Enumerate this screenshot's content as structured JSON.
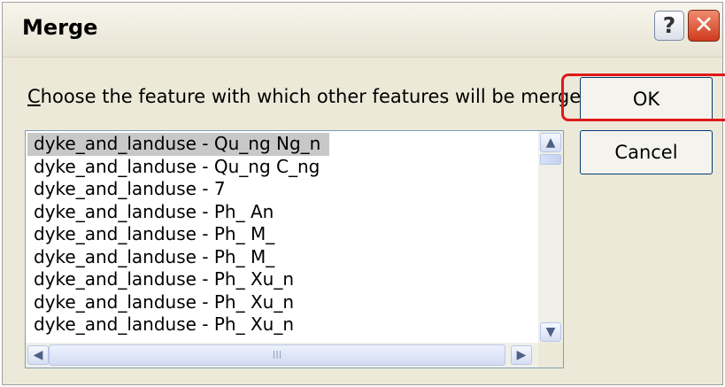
{
  "window": {
    "title": "Merge",
    "help_glyph": "?",
    "close_glyph": "✕"
  },
  "prompt": {
    "accel": "C",
    "rest": "hoose the feature with which other features will be merged:"
  },
  "buttons": {
    "ok_label": "OK",
    "cancel_label": "Cancel"
  },
  "list": {
    "selected_index": 0,
    "items": [
      "dyke_and_landuse - Qu_ng Ng_n",
      "dyke_and_landuse - Qu_ng C_ng",
      "dyke_and_landuse - 7",
      "dyke_and_landuse - Ph_ An",
      "dyke_and_landuse - Ph_ M_",
      "dyke_and_landuse - Ph_ M_",
      "dyke_and_landuse - Ph_ Xu_n",
      "dyke_and_landuse - Ph_ Xu_n",
      "dyke_and_landuse - Ph_ Xu_n"
    ]
  },
  "scroll": {
    "up_glyph": "▲",
    "down_glyph": "▼",
    "left_glyph": "◀",
    "right_glyph": "▶",
    "grip": "III"
  },
  "colors": {
    "highlight": "#e01818",
    "close_button": "#cf3b1d",
    "dialog_bg": "#ece9d8"
  }
}
